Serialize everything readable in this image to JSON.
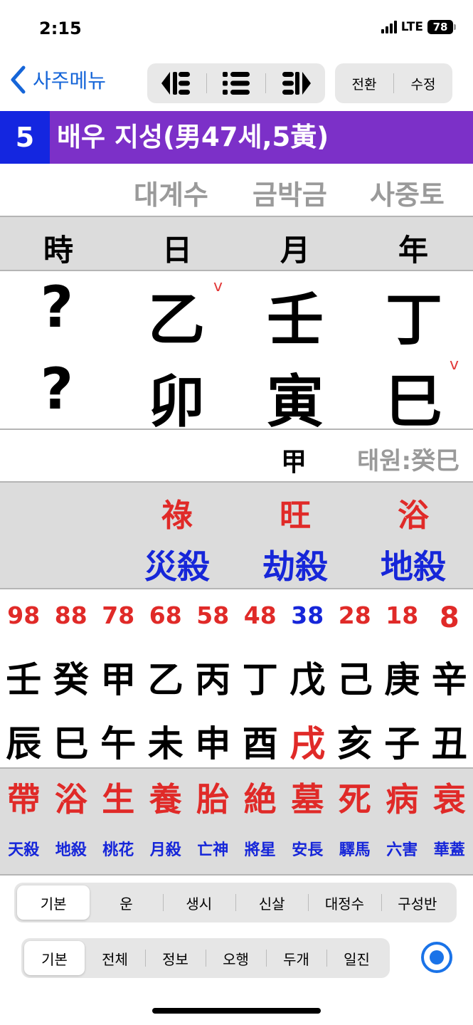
{
  "status": {
    "time": "2:15",
    "network": "LTE",
    "battery": "78"
  },
  "nav": {
    "back_label": "사주메뉴",
    "convert_label": "전환",
    "edit_label": "수정"
  },
  "title": {
    "number": "5",
    "text": "배우 지성(男47세,5黃)"
  },
  "nayin": [
    "대계수",
    "금박금",
    "사중토"
  ],
  "pillar_headers": [
    "時",
    "日",
    "月",
    "年"
  ],
  "stems": [
    "?",
    "乙",
    "壬",
    "丁"
  ],
  "branches": [
    "?",
    "卯",
    "寅",
    "巳"
  ],
  "check_mark": "v",
  "hidden_stem": "甲",
  "taewon": "태원:癸巳",
  "twelve_stages": [
    "祿",
    "旺",
    "浴"
  ],
  "spirit_kills": [
    "災殺",
    "劫殺",
    "地殺"
  ],
  "daeun": {
    "ages": [
      "98",
      "88",
      "78",
      "68",
      "58",
      "48",
      "38",
      "28",
      "18",
      "8"
    ],
    "stems": [
      "壬",
      "癸",
      "甲",
      "乙",
      "丙",
      "丁",
      "戊",
      "己",
      "庚",
      "辛"
    ],
    "branches": [
      "辰",
      "巳",
      "午",
      "未",
      "申",
      "酉",
      "戌",
      "亥",
      "子",
      "丑"
    ],
    "stages": [
      "帶",
      "浴",
      "生",
      "養",
      "胎",
      "絶",
      "墓",
      "死",
      "病",
      "衰"
    ],
    "spirits": [
      "天殺",
      "地殺",
      "桃花",
      "月殺",
      "亡神",
      "將星",
      "安長",
      "驛馬",
      "六害",
      "華蓋"
    ],
    "highlight_index": 6
  },
  "tabs_primary": [
    "기본",
    "운",
    "생시",
    "신살",
    "대정수",
    "구성반"
  ],
  "tabs_secondary": [
    "기본",
    "전체",
    "정보",
    "오행",
    "두개",
    "일진"
  ],
  "colors": {
    "purple": "#7c30c8",
    "blue": "#1426e0",
    "red": "#e02a28",
    "link": "#1565d8"
  }
}
